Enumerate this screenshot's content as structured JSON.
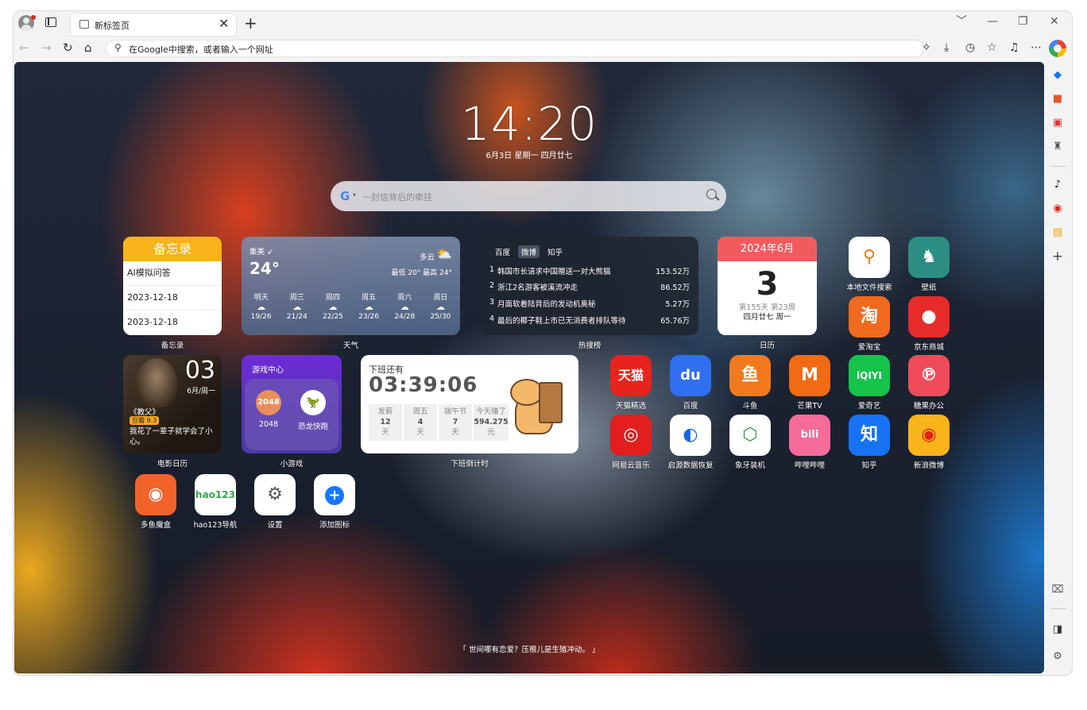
{
  "browser": {
    "tab_title": "新标签页",
    "tab_close": "✕",
    "new_tab": "+",
    "address_placeholder": "在Google中搜索，或者输入一个网址",
    "window_controls": [
      "﹀",
      "—",
      "❐",
      "✕"
    ]
  },
  "clock": {
    "time": "14:20",
    "date": "6月3日 星期一 四月廿七"
  },
  "search": {
    "placeholder": "一封信背后的牵挂"
  },
  "memo": {
    "title": "备忘录",
    "items": [
      "AI模拟问答",
      "2023-12-18",
      "2023-12-18"
    ],
    "caption": "备忘录"
  },
  "weather": {
    "city": "集美",
    "city_arrow": "➶",
    "temp": "24°",
    "condition": "多云",
    "range": "最低 20° 最高 24°",
    "caption": "天气",
    "forecast": [
      {
        "day": "明天",
        "icon": "snow-cloud-icon",
        "range": "19/26"
      },
      {
        "day": "周三",
        "icon": "snow-cloud-icon",
        "range": "21/24"
      },
      {
        "day": "周四",
        "icon": "snow-cloud-icon",
        "range": "22/25"
      },
      {
        "day": "周五",
        "icon": "snow-cloud-icon",
        "range": "23/26"
      },
      {
        "day": "周六",
        "icon": "cloud-icon",
        "range": "24/28"
      },
      {
        "day": "周日",
        "icon": "cloud-icon",
        "range": "25/30"
      }
    ]
  },
  "hot": {
    "tabs": [
      "百度",
      "微博",
      "知乎"
    ],
    "active_tab": "微博",
    "items": [
      {
        "n": "1",
        "title": "韩国市长请求中国赠送一对大熊猫",
        "value": "153.52万"
      },
      {
        "n": "2",
        "title": "浙江2名游客被溪流冲走",
        "value": "86.52万"
      },
      {
        "n": "3",
        "title": "月面软着陆背后的发动机奥秘",
        "value": "5.27万"
      },
      {
        "n": "4",
        "title": "最后的椰子鞋上市已无消费者排队等待",
        "value": "65.76万"
      }
    ],
    "caption": "热搜榜"
  },
  "calendar": {
    "month": "2024年6月",
    "day": "3",
    "line1": "第155天 第23周",
    "line2": "四月廿七 周一",
    "caption": "日历"
  },
  "movie": {
    "day": "03",
    "date": "6月/周一",
    "name": "《教父》",
    "badge": "豆瓣 9.3",
    "quote": "我花了一辈子就学会了小心。",
    "caption": "电影日历"
  },
  "game": {
    "title": "游戏中心",
    "g1_icon": "2048",
    "g1_label": "2048",
    "g2_label": "恐龙快跑",
    "caption": "小游戏"
  },
  "countdown": {
    "title": "下班还有",
    "time": "03:39:06",
    "boxes": [
      {
        "a": "发薪",
        "b": "12",
        "c": "天"
      },
      {
        "a": "周五",
        "b": "4",
        "c": "天"
      },
      {
        "a": "端午节",
        "b": "7",
        "c": "天"
      },
      {
        "a": "今天赚了",
        "b": "594.275",
        "c": "元"
      }
    ],
    "caption": "下班倒计时"
  },
  "apps": [
    {
      "label": "本地文件搜索",
      "glyph": "⚲",
      "bg": "#ffffff",
      "fg": "#f07a1a"
    },
    {
      "label": "壁纸",
      "glyph": "♞",
      "bg": "#2c8e83",
      "fg": "#ffffff"
    },
    {
      "label": "爱淘宝",
      "glyph": "淘",
      "bg": "#f06a1f",
      "fg": "#ffffff"
    },
    {
      "label": "京东商城",
      "glyph": "●",
      "bg": "#e62b2b",
      "fg": "#ffffff"
    },
    {
      "label": "天猫精选",
      "glyph": "天猫",
      "bg": "#e8231d",
      "fg": "#ffffff"
    },
    {
      "label": "百度",
      "glyph": "du",
      "bg": "#2f6ff0",
      "fg": "#ffffff"
    },
    {
      "label": "斗鱼",
      "glyph": "鱼",
      "bg": "#f27a1e",
      "fg": "#ffffff"
    },
    {
      "label": "芒果TV",
      "glyph": "M",
      "bg": "#f26a12",
      "fg": "#ffffff"
    },
    {
      "label": "爱奇艺",
      "glyph": "iQIYI",
      "bg": "#16c34b",
      "fg": "#ffffff"
    },
    {
      "label": "糖果办公",
      "glyph": "℗",
      "bg": "#f04b5a",
      "fg": "#ffffff"
    },
    {
      "label": "网易云音乐",
      "glyph": "◎",
      "bg": "#e21e1e",
      "fg": "#ffffff"
    },
    {
      "label": "启源数据恢复",
      "glyph": "◐",
      "bg": "#ffffff",
      "fg": "#1566e0"
    },
    {
      "label": "象牙装机",
      "glyph": "⬡",
      "bg": "#ffffff",
      "fg": "#2a9a46"
    },
    {
      "label": "哔哩哔哩",
      "glyph": "bili",
      "bg": "#f56b9a",
      "fg": "#ffffff"
    },
    {
      "label": "知乎",
      "glyph": "知",
      "bg": "#1772f6",
      "fg": "#ffffff"
    },
    {
      "label": "新浪微博",
      "glyph": "◉",
      "bg": "#f9b31b",
      "fg": "#e2231a"
    },
    {
      "label": "多鱼魔盒",
      "glyph": "◉",
      "bg": "#f2632a",
      "fg": "#ffffff"
    },
    {
      "label": "hao123导航",
      "glyph": "hao123",
      "bg": "#ffffff",
      "fg": "#3aa34a"
    },
    {
      "label": "设置",
      "glyph": "⚙",
      "bg": "#ffffff",
      "fg": "#555555"
    },
    {
      "label": "添加图标",
      "glyph": "+",
      "bg": "#ffffff",
      "fg": "#1677ff"
    }
  ],
  "quote": "「 世间哪有恋爱？压根儿是生殖冲动。 」",
  "sidebar_icons": [
    "tag-icon",
    "office-icon",
    "toolbox-icon",
    "chess-icon",
    "tiktok-icon",
    "weibo-icon",
    "news-icon",
    "add-icon",
    "screenshot-icon",
    "sidebar-toggle-icon",
    "settings-icon"
  ]
}
